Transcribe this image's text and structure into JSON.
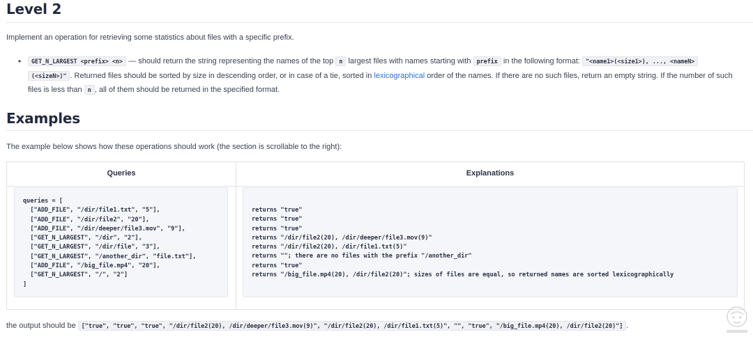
{
  "level_section": {
    "heading": "Level 2",
    "intro": "Implement an operation for retrieving some statistics about files with a specific prefix.",
    "bullet": {
      "cmd_code": "GET_N_LARGEST <prefix> <n>",
      "t1": " — should return the string representing the names of the top ",
      "n_code": "n",
      "t2": " largest files with names starting with ",
      "prefix_code": "prefix",
      "t3": " in the following format: ",
      "format_code_1": "\"<name1>(<size1>), ..., <nameN>",
      "format_code_2": "(<sizeN>)\"",
      "t4": ". Returned files should be sorted by size in descending order, or in case of a tie, sorted in ",
      "link_text": "lexicographical",
      "t5": " order of the names. If there are no such files, return an empty string. If the number of such",
      "t6": "files is less than ",
      "n_code_2": "n",
      "t7": ", all of them should be returned in the specified format."
    }
  },
  "examples_section": {
    "heading": "Examples",
    "intro": "The example below shows how these operations should work (the section is scrollable to the right):",
    "table": {
      "headers": [
        "Queries",
        "Explanations"
      ],
      "queries_code": "queries = [\n  [\"ADD_FILE\", \"/dir/file1.txt\", \"5\"],\n  [\"ADD_FILE\", \"/dir/file2\", \"20\"],\n  [\"ADD_FILE\", \"/dir/deeper/file3.mov\", \"9\"],\n  [\"GET_N_LARGEST\", \"/dir\", \"2\"],\n  [\"GET_N_LARGEST\", \"/dir/file\", \"3\"],\n  [\"GET_N_LARGEST\", \"/another_dir\", \"file.txt\"],\n  [\"ADD_FILE\", \"/big_file.mp4\", \"20\"],\n  [\"GET_N_LARGEST\", \"/\", \"2\"]\n]",
      "explanations_code": "returns \"true\"\nreturns \"true\"\nreturns \"true\"\nreturns \"/dir/file2(20), /dir/deeper/file3.mov(9)\"\nreturns \"/dir/file2(20), /dir/file1.txt(5)\"\nreturns \"\"; there are no files with the prefix \"/another_dir\"\nreturns \"true\"\nreturns \"/big_file.mp4(20), /dir/file2(20)\"; sizes of files are equal, so returned names are sorted lexicographically"
    },
    "output_prefix": "the output should be ",
    "output_code": "[\"true\", \"true\", \"true\", \"/dir/file2(20), /dir/deeper/file3.mov(9)\", \"/dir/file2(20), /dir/file1.txt(5)\", \"\", \"true\", \"/big_file.mp4(20), /dir/file2(20)\"]",
    "output_suffix": "."
  }
}
